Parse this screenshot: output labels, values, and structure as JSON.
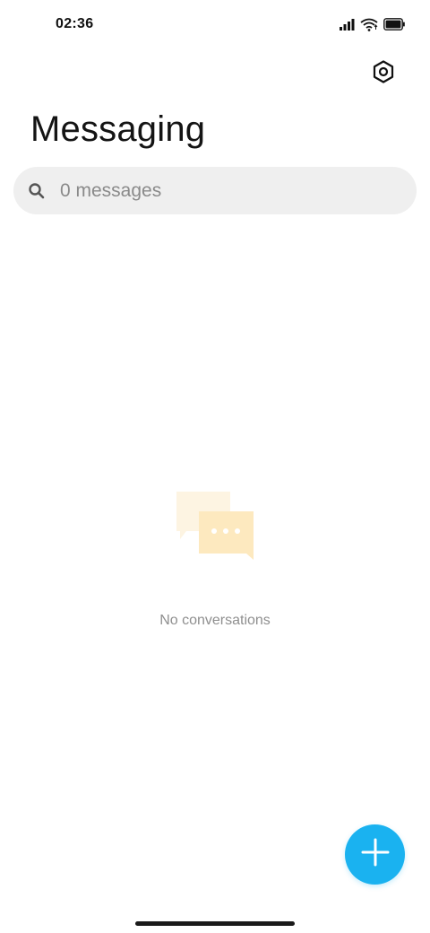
{
  "status_bar": {
    "time": "02:36",
    "icons": [
      "signal-icon",
      "wifi-icon",
      "battery-icon"
    ]
  },
  "header": {
    "title": "Messaging",
    "settings_icon": "settings-icon"
  },
  "search": {
    "placeholder": "0 messages",
    "value": "",
    "icon": "search-icon"
  },
  "empty_state": {
    "icon": "chat-bubbles-icon",
    "text": "No conversations"
  },
  "fab": {
    "icon": "plus-icon"
  },
  "colors": {
    "accent": "#1ab2f0",
    "bubble_back": "#fdf3de",
    "bubble_front": "#fde9bd",
    "search_bg": "#efefef"
  }
}
